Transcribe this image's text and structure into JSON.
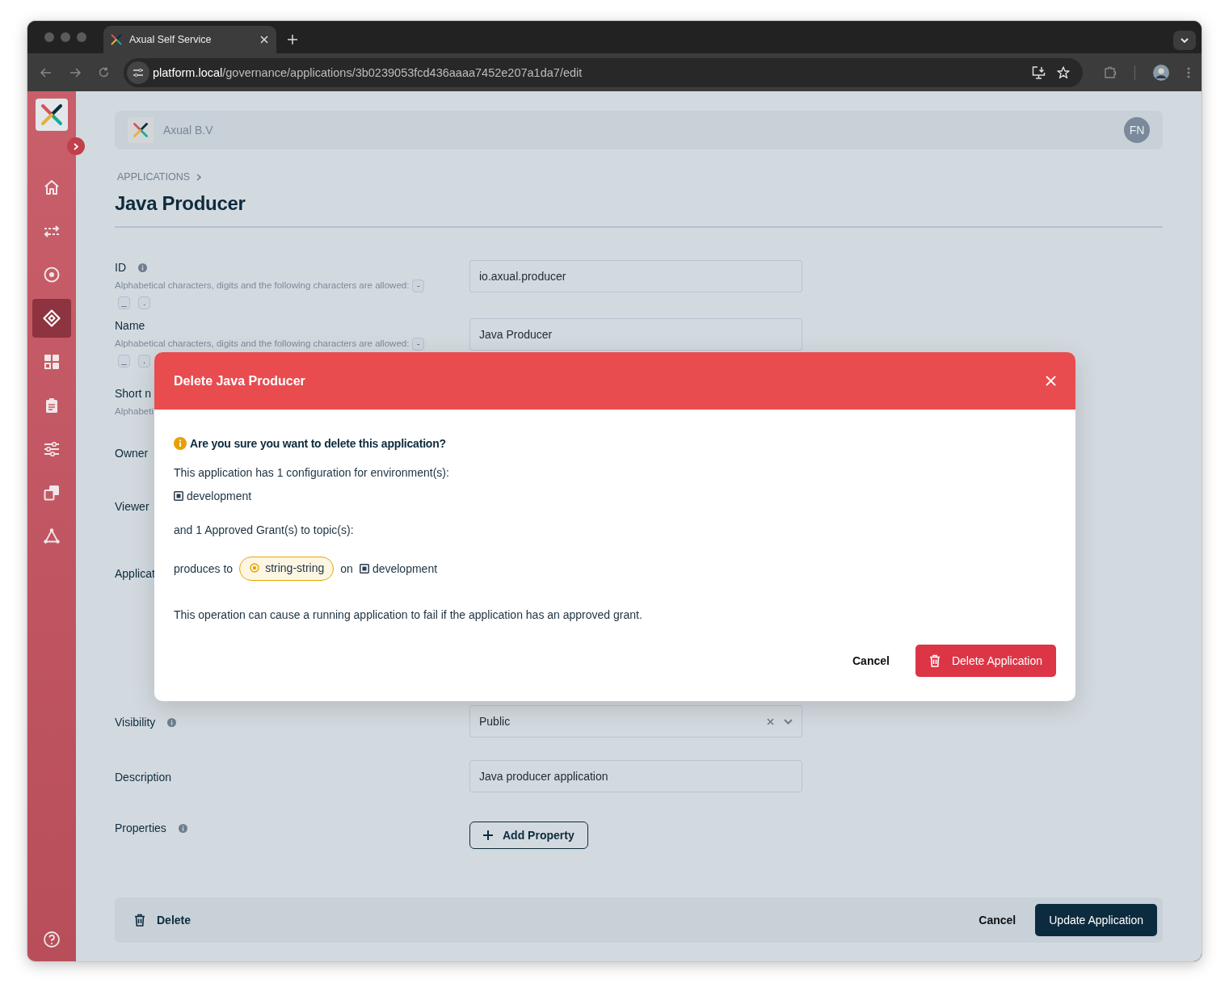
{
  "browser": {
    "tab_title": "Axual Self Service",
    "url": {
      "host": "platform.local",
      "path": "/governance/applications/3b0239053fcd436aaaa7452e207a1da7/edit"
    }
  },
  "sidebar": {
    "items": [
      {
        "kind": "home",
        "selected": false
      },
      {
        "kind": "transfer",
        "selected": false
      },
      {
        "kind": "target",
        "selected": false
      },
      {
        "kind": "diamond",
        "selected": true
      },
      {
        "kind": "grid",
        "selected": false
      },
      {
        "kind": "clipboard",
        "selected": false
      },
      {
        "kind": "sliders",
        "selected": false
      },
      {
        "kind": "copy",
        "selected": false
      },
      {
        "kind": "network",
        "selected": false
      }
    ]
  },
  "header": {
    "org_name": "Axual B.V",
    "avatar": "FN"
  },
  "breadcrumb": [
    "APPLICATIONS"
  ],
  "title": "Java Producer",
  "fields": [
    {
      "kind": "input",
      "label": "ID",
      "info": true,
      "hint": "Alphabetical characters, digits and the following characters are allowed:",
      "chips": [
        "-",
        "_",
        "."
      ],
      "value": "io.axual.producer"
    },
    {
      "kind": "input",
      "label": "Name",
      "info": false,
      "hint": "Alphabetical characters, digits and the following characters are allowed:",
      "chips": [
        "-",
        "_",
        "."
      ],
      "value": "Java Producer"
    },
    {
      "kind": "covered",
      "label": "Short n",
      "info": false,
      "hint": "Alphabeti"
    },
    {
      "kind": "covered",
      "label": "Owner",
      "info": false
    },
    {
      "kind": "covered",
      "label": "Viewer",
      "info": false
    },
    {
      "kind": "covered",
      "label": "Applicat",
      "info": false
    },
    {
      "kind": "select",
      "label": "Visibility",
      "info": true,
      "value": "Public"
    },
    {
      "kind": "input",
      "label": "Description",
      "info": false,
      "value": "Java producer application"
    },
    {
      "kind": "button",
      "label": "Properties",
      "info": true,
      "button": "Add Property"
    }
  ],
  "footer": {
    "delete": "Delete",
    "cancel": "Cancel",
    "submit": "Update Application"
  },
  "modal": {
    "title": "Delete Java Producer",
    "question": "Are you sure you want to delete this application?",
    "config_text": "This application has 1 configuration for environment(s):",
    "environments": [
      "development"
    ],
    "grants_text": "and 1 Approved Grant(s) to topic(s):",
    "grants": [
      {
        "verb": "produces to",
        "topic": "string-string",
        "joiner": "on",
        "environment": "development"
      }
    ],
    "warning": "This operation can cause a running application to fail if the application has an approved grant.",
    "cancel": "Cancel",
    "confirm": "Delete Application"
  }
}
